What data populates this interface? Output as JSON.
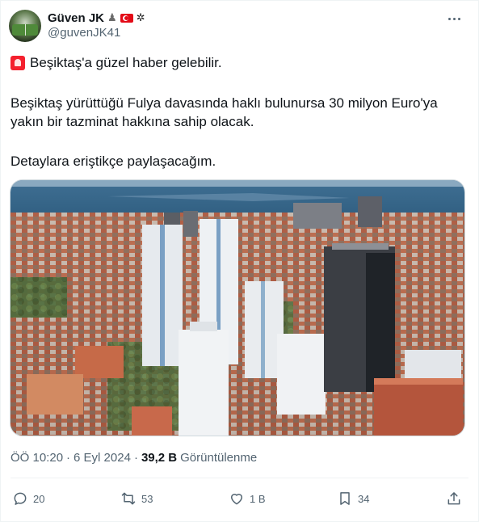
{
  "author": {
    "display_name": "Güven JK",
    "handle": "@guvenJK41",
    "badges": [
      "chess-icon",
      "turkey-flag-icon",
      "bat-icon"
    ]
  },
  "tweet": {
    "line1": "Beşiktaş'a güzel haber gelebilir.",
    "line2": "Beşiktaş yürüttüğü Fulya davasında haklı bulunursa 30 milyon Euro'ya yakın bir tazminat hakkına sahip olacak.",
    "line3": "Detaylara eriştikçe paylaşacağım.",
    "image": "istanbul-skyline-photo"
  },
  "meta": {
    "time": "ÖÖ 10:20",
    "separator": "·",
    "date": "6 Eyl 2024",
    "views_count": "39,2 B",
    "views_label": "Görüntülenme"
  },
  "actions": {
    "replies": "20",
    "retweets": "53",
    "likes": "1 B",
    "bookmarks": "34"
  },
  "colors": {
    "text": "#0f1419",
    "secondary": "#536471",
    "siren": "#f4212e"
  }
}
